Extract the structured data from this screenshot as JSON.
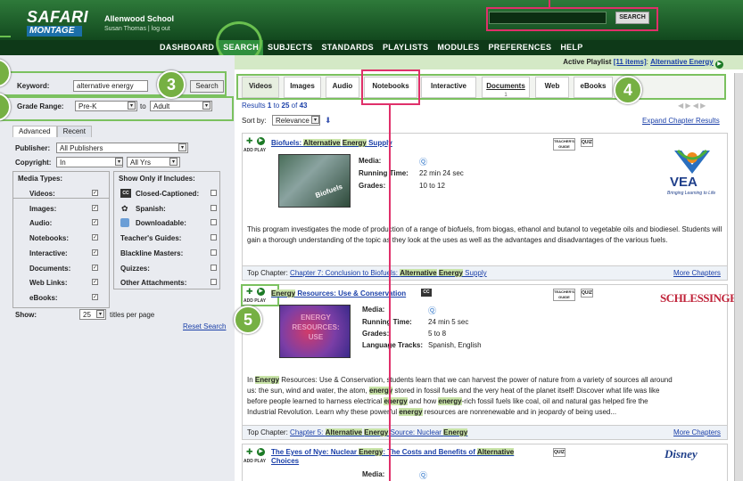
{
  "header": {
    "logo_top": "SAFARI",
    "logo_bottom": "MONTAGE",
    "school": "Allenwood School",
    "user": "Susan Thomas | log out",
    "search_button": "SEARCH"
  },
  "nav": [
    "DASHBOARD",
    "SEARCH",
    "SUBJECTS",
    "STANDARDS",
    "PLAYLISTS",
    "MODULES",
    "PREFERENCES",
    "HELP"
  ],
  "active_nav": "SEARCH",
  "playlist": {
    "label": "Active Playlist",
    "count": "[11 items]",
    "name": "Alternative Energy"
  },
  "sidebar": {
    "keyword_label": "Keyword:",
    "keyword_value": "alternative energy",
    "search_button": "Search",
    "grade_label": "Grade Range:",
    "grade_from": "Pre-K",
    "grade_to_label": "to",
    "grade_to": "Adult",
    "tab_advanced": "Advanced",
    "tab_recent": "Recent",
    "publisher_label": "Publisher:",
    "publisher_value": "All Publishers",
    "copyright_label": "Copyright:",
    "copyright_value": "In",
    "copyright_years": "All Yrs",
    "media_types_title": "Media Types:",
    "media_types": [
      "Videos:",
      "Images:",
      "Audio:",
      "Notebooks:",
      "Interactive:",
      "Documents:",
      "Web Links:",
      "eBooks:"
    ],
    "only_title": "Show Only if Includes:",
    "only_items": [
      "Closed-Captioned:",
      "Spanish:",
      "Downloadable:",
      "Teacher's Guides:",
      "Blackline Masters:",
      "Quizzes:",
      "Other Attachments:"
    ],
    "cc_badge": "CC",
    "show_label": "Show:",
    "show_value": "25",
    "show_suffix": "titles per page",
    "reset": "Reset Search"
  },
  "content_tabs": [
    "Videos",
    "Images",
    "Audio",
    "Notebooks",
    "Interactive",
    "Documents",
    "Web",
    "eBooks"
  ],
  "documents_count": "1",
  "results": {
    "text_prefix": "Results",
    "from": "1",
    "to_word": "to",
    "to": "25",
    "of_word": "of",
    "total": "43",
    "sort_label": "Sort by:",
    "sort_value": "Relevance",
    "expand": "Expand Chapter Results"
  },
  "badges": {
    "b3": "3",
    "b4": "4",
    "b5": "5"
  },
  "cards": [
    {
      "title_a": "Biofuels: ",
      "title_hl1": "Alternative",
      "title_b": " ",
      "title_hl2": "Energy",
      "title_c": " Supply",
      "media_label": "Media:",
      "time_label": "Running Time:",
      "time": "22 min 24 sec",
      "grades_label": "Grades:",
      "grades": "10 to 12",
      "thumb_text": "Biofuels",
      "publisher": "VEA",
      "publisher_tag": "Bringing Learning to Life",
      "desc": "This program investigates the mode of production of a range of biofuels, from biogas, ethanol and butanol to vegetable oils and biodiesel. Students will gain a thorough understanding of the topic as they look at the uses as well as the advantages and disadvantages of the various fuels.",
      "chapter_label": "Top Chapter:",
      "chapter_a": "Chapter 7: Conclusion to Biofuels: ",
      "chapter_hl1": "Alternative",
      "chapter_b": " ",
      "chapter_hl2": "Energy",
      "chapter_c": " Supply",
      "more": "More Chapters"
    },
    {
      "title_a": "",
      "title_hl1": "Energy",
      "title_b": " Resources: Use & Conservation",
      "cc": "CC",
      "media_label": "Media:",
      "time_label": "Running Time:",
      "time": "24 min 5 sec",
      "grades_label": "Grades:",
      "grades": "5 to 8",
      "lang_label": "Language Tracks:",
      "lang": "Spanish, English",
      "thumb_text": "ENERGY RESOURCES: USE",
      "publisher": "SCHLESSINGER",
      "desc1_a": "In ",
      "desc1_hl": "Energy",
      "desc1_b": " Resources: Use & Conservation, students learn that we can harvest the power of nature from a variety of sources all around",
      "desc2_a": "us: the sun, wind and water, the atom, ",
      "desc2_hl": "energy",
      "desc2_b": " stored in fossil fuels and the very heat of the planet itself! Discover what life was like",
      "desc3_a": "before people learned to harness electrical ",
      "desc3_hl1": "energy",
      "desc3_b": " and how ",
      "desc3_hl2": "energy",
      "desc3_c": "-rich fossil fuels like coal, oil and natural gas helped fire the",
      "desc4_a": "Industrial Revolution. Learn why these powerful ",
      "desc4_hl": "energy",
      "desc4_b": " resources are nonrenewable and in jeopardy of being used...",
      "chapter_label": "Top Chapter:",
      "chapter_a": "Chapter 5: ",
      "chapter_hl1": "Alternative",
      "chapter_b": " ",
      "chapter_hl2": "Energy",
      "chapter_c": " Source: Nuclear ",
      "chapter_hl3": "Energy",
      "more": "More Chapters"
    },
    {
      "title_a": "The Eyes of Nye: Nuclear ",
      "title_hl1": "Energy",
      "title_b": ": The Costs and Benefits of ",
      "title_hl2": "Alternative",
      "title_c": "Choices",
      "media_label": "Media:",
      "publisher": "Disney"
    }
  ],
  "labels": {
    "add_play": "ADD PLAY",
    "guide": "TEACHER'S GUIDE",
    "quiz": "QUIZ"
  },
  "colors": {
    "green": "#76b043",
    "pink": "#e0306a",
    "link": "#1a3fa8"
  }
}
